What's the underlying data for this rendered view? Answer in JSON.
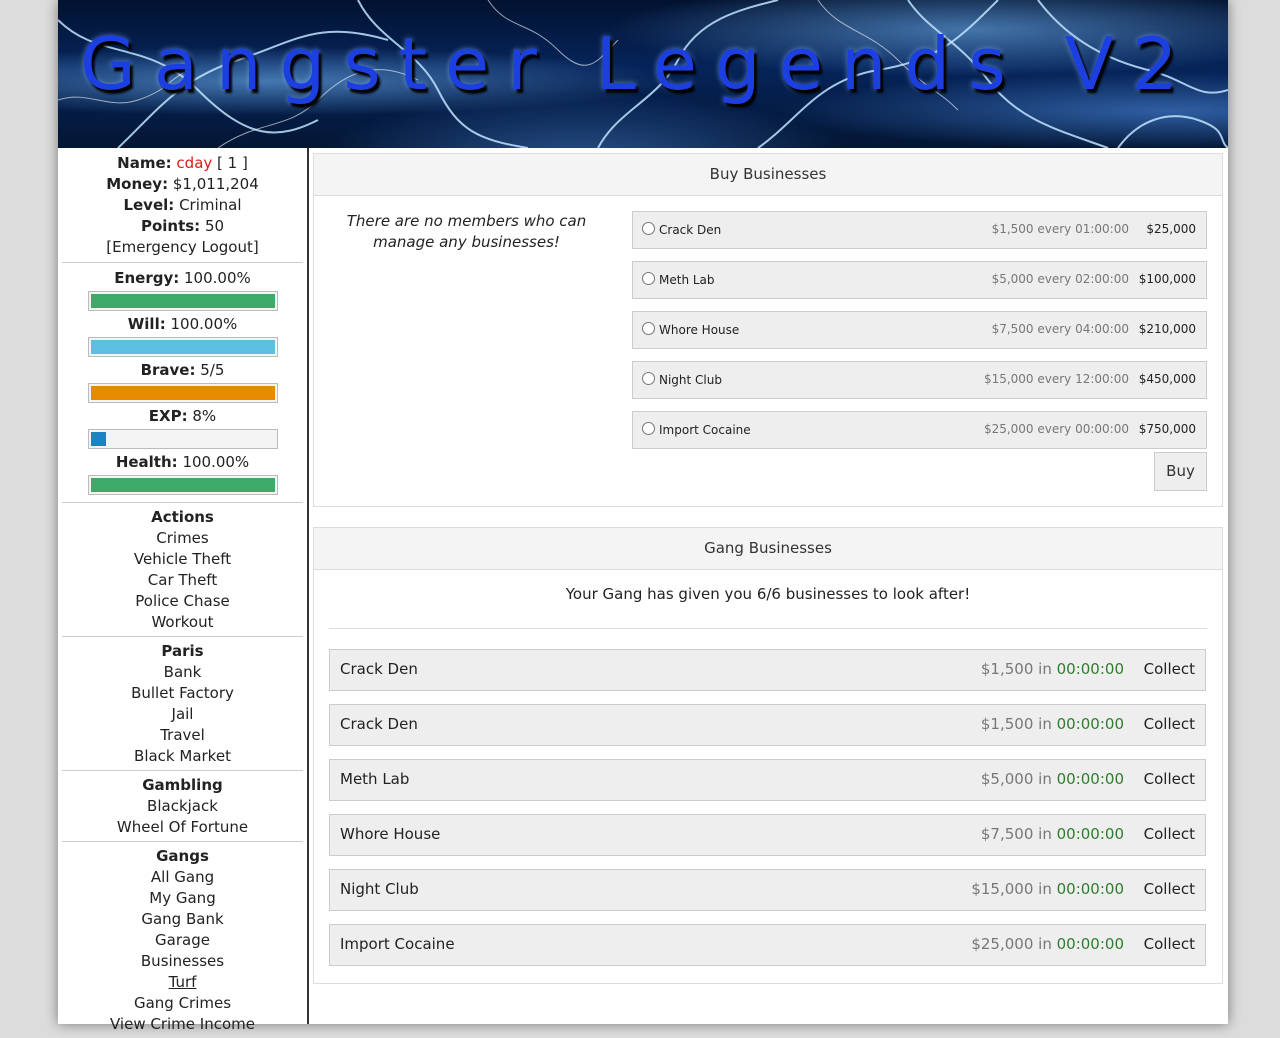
{
  "header": {
    "title": "Gangster Legends V2"
  },
  "colors": {
    "energy": "#3daa6a",
    "will": "#5bc0de",
    "brave": "#e68a00",
    "exp": "#1a83c2",
    "health": "#3daa6a",
    "name_accent": "#e01818",
    "timer_green": "#2e7d2e"
  },
  "user": {
    "name_label": "Name:",
    "name": "cday",
    "id": "[ 1 ]",
    "money_label": "Money:",
    "money": "$1,011,204",
    "level_label": "Level:",
    "level": "Criminal",
    "points_label": "Points:",
    "points": "50",
    "logout": "[Emergency Logout]"
  },
  "stats": [
    {
      "label": "Energy:",
      "value": "100.00%",
      "fill": 1.0
    },
    {
      "label": "Will:",
      "value": "100.00%",
      "fill": 1.0
    },
    {
      "label": "Brave:",
      "value": "5/5",
      "fill": 1.0
    },
    {
      "label": "EXP:",
      "value": "8%",
      "fill": 0.08
    },
    {
      "label": "Health:",
      "value": "100.00%",
      "fill": 1.0
    }
  ],
  "nav": {
    "actions": {
      "title": "Actions",
      "items": [
        "Crimes",
        "Vehicle Theft",
        "Car Theft",
        "Police Chase",
        "Workout"
      ]
    },
    "city": {
      "title": "Paris",
      "items": [
        "Bank",
        "Bullet Factory",
        "Jail",
        "Travel",
        "Black Market"
      ]
    },
    "gambling": {
      "title": "Gambling",
      "items": [
        "Blackjack",
        "Wheel Of Fortune"
      ]
    },
    "gangs": {
      "title": "Gangs",
      "items": [
        "All Gang",
        "My Gang",
        "Gang Bank",
        "Garage",
        "Businesses",
        "Turf",
        "Gang Crimes",
        "View Crime Income"
      ]
    }
  },
  "buy": {
    "title": "Buy Businesses",
    "note": "There are no members who can manage any businesses!",
    "options": [
      {
        "name": "Crack Den",
        "income": "$1,500 every 01:00:00",
        "price": "$25,000"
      },
      {
        "name": "Meth Lab",
        "income": "$5,000 every 02:00:00",
        "price": "$100,000"
      },
      {
        "name": "Whore House",
        "income": "$7,500 every 04:00:00",
        "price": "$210,000"
      },
      {
        "name": "Night Club",
        "income": "$15,000 every 12:00:00",
        "price": "$450,000"
      },
      {
        "name": "Import Cocaine",
        "income": "$25,000 every 00:00:00",
        "price": "$750,000"
      }
    ],
    "button": "Buy"
  },
  "gang_businesses": {
    "title": "Gang Businesses",
    "message": "Your Gang has given you 6/6 businesses to look after!",
    "in_word": "in",
    "collect_label": "Collect",
    "rows": [
      {
        "name": "Crack Den",
        "amount": "$1,500",
        "time": "00:00:00"
      },
      {
        "name": "Crack Den",
        "amount": "$1,500",
        "time": "00:00:00"
      },
      {
        "name": "Meth Lab",
        "amount": "$5,000",
        "time": "00:00:00"
      },
      {
        "name": "Whore House",
        "amount": "$7,500",
        "time": "00:00:00"
      },
      {
        "name": "Night Club",
        "amount": "$15,000",
        "time": "00:00:00"
      },
      {
        "name": "Import Cocaine",
        "amount": "$25,000",
        "time": "00:00:00"
      }
    ]
  }
}
